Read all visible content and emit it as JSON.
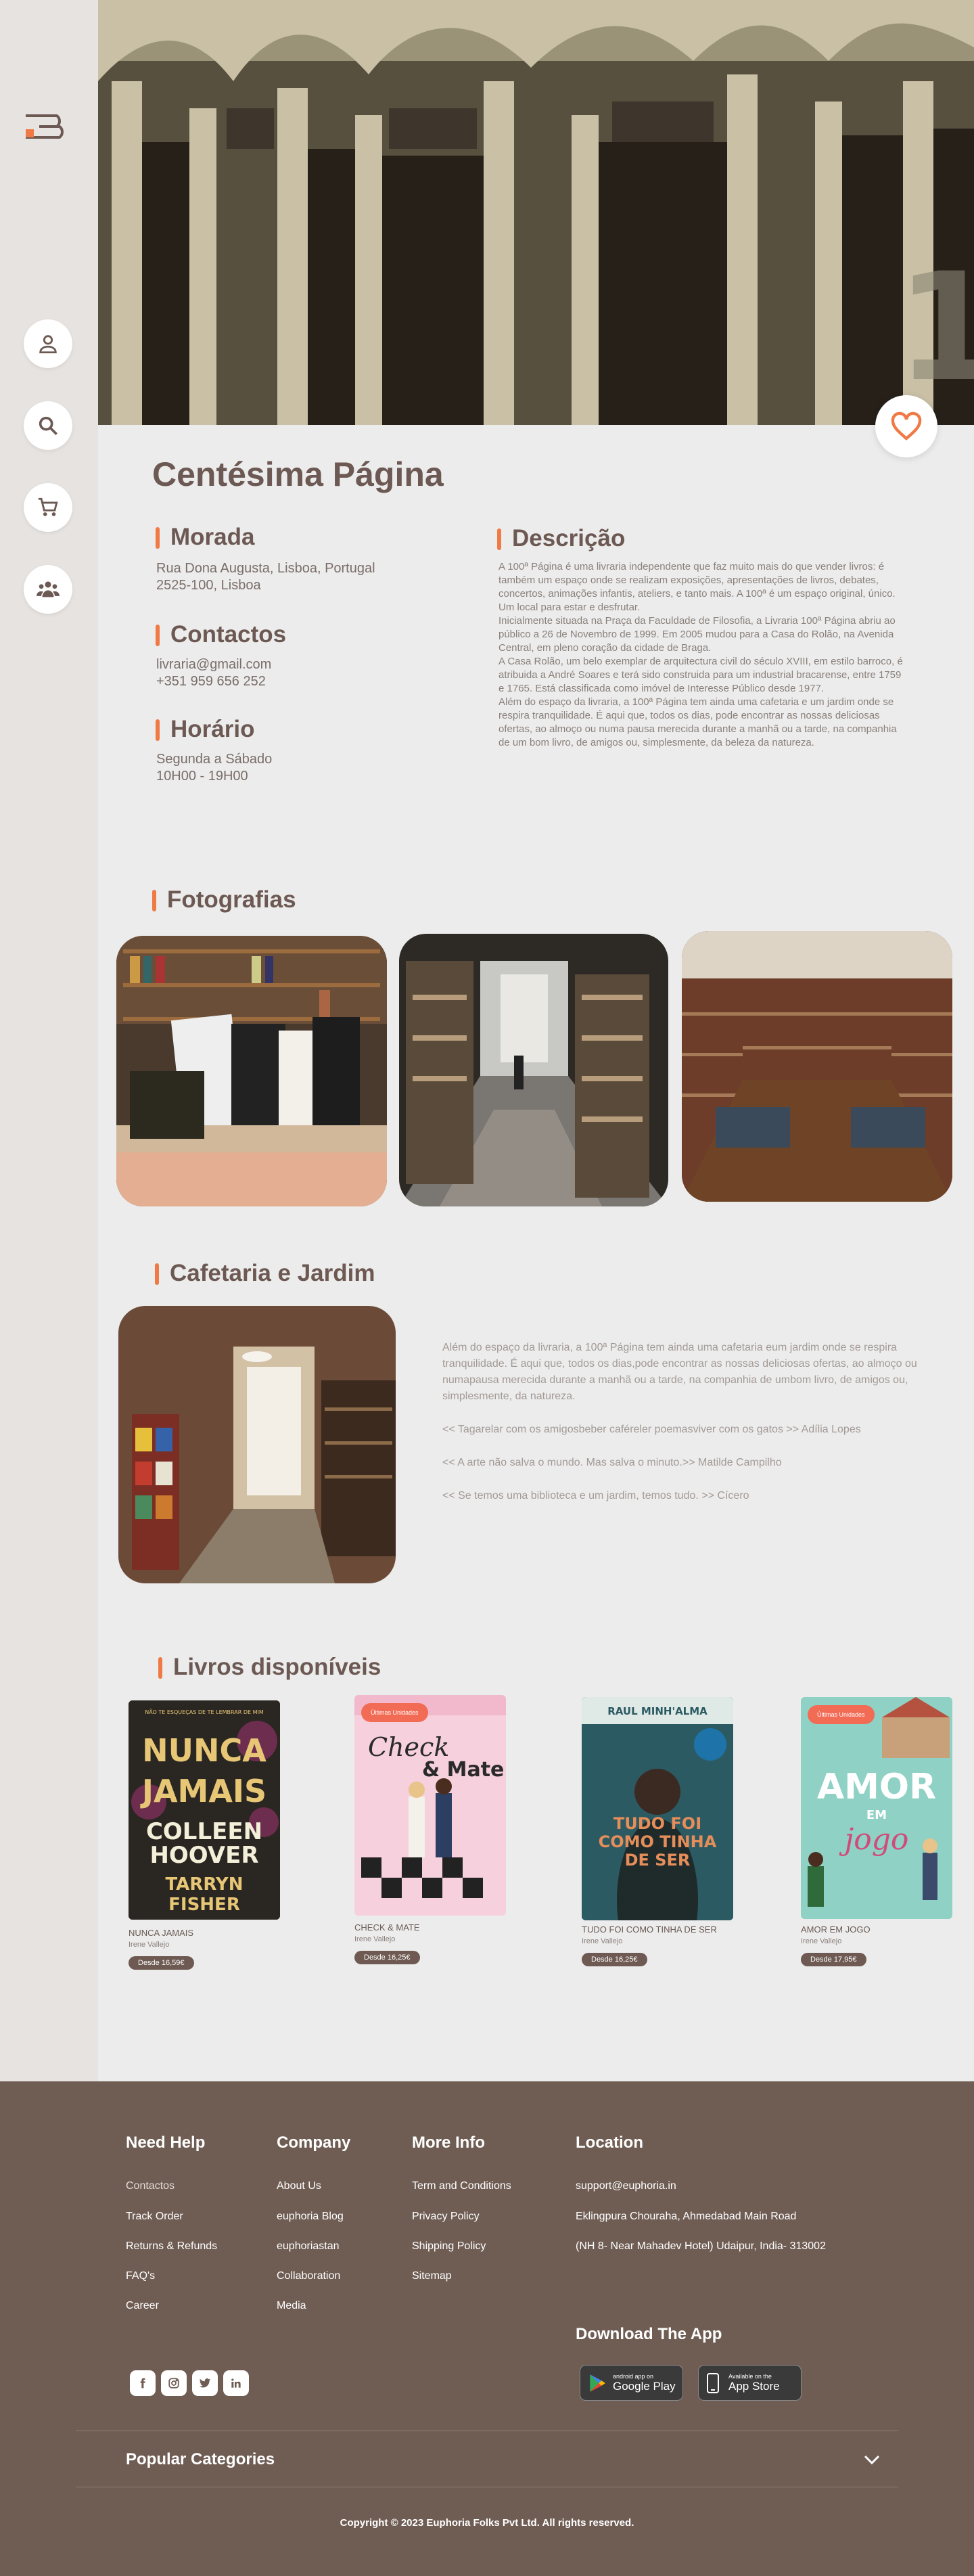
{
  "sidebar": {
    "logo_icon": "bookstore-logo-icon",
    "buttons": [
      {
        "name": "profile",
        "icon": "user-icon"
      },
      {
        "name": "search",
        "icon": "search-icon"
      },
      {
        "name": "cart",
        "icon": "cart-icon"
      },
      {
        "name": "community",
        "icon": "group-icon"
      }
    ]
  },
  "hero": {
    "favorite_icon": "heart-icon",
    "accent_color": "#ef7a45"
  },
  "store": {
    "name": "Centésima Página",
    "address_heading": "Morada",
    "address_lines": [
      "Rua Dona Augusta, Lisboa, Portugal",
      "2525-100, Lisboa"
    ],
    "contacts_heading": "Contactos",
    "contacts_lines": [
      "livraria@gmail.com",
      "+351 959 656 252"
    ],
    "hours_heading": "Horário",
    "hours_lines": [
      "Segunda a Sábado",
      "10H00 - 19H00"
    ],
    "description_heading": "Descrição",
    "description_paragraphs": [
      "A 100ª Página é uma livraria independente que faz muito mais do que vender livros: é também um espaço onde se realizam exposições, apresentações de livros, debates, concertos, animações infantis, ateliers, e tanto mais. A 100ª é um espaço original, único. Um local para estar e desfrutar.",
      "Inicialmente situada na Praça da Faculdade de Filosofia, a Livraria 100ª Página abriu ao público a 26 de Novembro de 1999. Em 2005 mudou para a Casa do Rolão, na Avenida Central, em pleno coração da cidade de Braga.",
      "A Casa Rolão, um belo exemplar de arquitectura civil do século XVIII, em estilo barroco, é atribuida a André Soares e terá sido construida para um industrial bracarense, entre 1759 e 1765. Está classificada como imóvel de Interesse Público desde 1977.",
      "Além do espaço da livraria, a 100ª Página tem ainda uma cafetaria e um jardim onde se respira tranquilidade. É aqui que, todos os dias, pode encontrar as nossas deliciosas ofertas, ao almoço ou numa pausa merecida durante a manhã ou a tarde, na companhia de um bom livro, de amigos ou, simplesmente, da beleza da natureza."
    ]
  },
  "photos": {
    "heading": "Fotografias"
  },
  "cafe": {
    "heading": "Cafetaria e Jardim",
    "paragraphs": [
      "Além do espaço da livraria, a 100ª Página tem ainda uma cafetaria eum jardim onde se respira tranquilidade. É aqui que, todos os dias,pode encontrar as nossas deliciosas ofertas, ao almoço ou numapausa merecida durante a manhã ou a tarde, na companhia de umbom livro, de amigos ou, simplesmente, da natureza.",
      "<< Tagarelar com os amigosbeber caféreler poemasviver com os gatos >> Adília Lopes",
      "<< A arte não salva o mundo. Mas salva o minuto.>> Matilde Campilho",
      "<< Se temos uma biblioteca e um jardim, temos tudo. >> Cícero"
    ]
  },
  "books": {
    "heading": "Livros disponíveis",
    "items": [
      {
        "title": "NUNCA JAMAIS",
        "author": "Irene Vallejo",
        "price": "Desde 16,59€",
        "cover_lines": [
          "NUNCA",
          "JAMAIS",
          "COLLEEN",
          "HOOVER",
          "TARRYN",
          "FISHER"
        ],
        "cover_top": "NÃO TE ESQUEÇAS DE TE LEMBRAR DE MIM",
        "color": "#2a2622"
      },
      {
        "title": "CHECK & MATE",
        "author": "Irene Vallejo",
        "price": "Desde 16,25€",
        "cover_lines": [
          "Check",
          "& Mate"
        ],
        "badge": "Últimas Unidades",
        "color": "#f4c6d6"
      },
      {
        "title": "TUDO FOI COMO TINHA DE SER",
        "author": "Irene Vallejo",
        "price": "Desde 16,25€",
        "cover_lines": [
          "RAUL MINH'ALMA",
          "TUDO FOI",
          "COMO TINHA",
          "DE SER"
        ],
        "color": "#2c5a63"
      },
      {
        "title": "AMOR EM JOGO",
        "author": "Irene Vallejo",
        "price": "Desde 17,95€",
        "cover_lines": [
          "AMOR",
          "EM",
          "jogo"
        ],
        "badge": "Últimas Unidades",
        "color": "#8fd1c4"
      }
    ]
  },
  "footer": {
    "need_help": {
      "heading": "Need Help",
      "links": [
        "Contactos",
        "Track Order",
        "Returns & Refunds",
        "FAQ's",
        "Career"
      ]
    },
    "company": {
      "heading": "Company",
      "links": [
        "About Us",
        "euphoria Blog",
        "euphoriastan",
        "Collaboration",
        "Media"
      ]
    },
    "more_info": {
      "heading": "More Info",
      "links": [
        "Term and Conditions",
        "Privacy Policy",
        "Shipping Policy",
        "Sitemap"
      ]
    },
    "location": {
      "heading": "Location",
      "lines": [
        "support@euphoria.in",
        "Eklingpura Chouraha, Ahmedabad Main Road",
        "(NH 8- Near Mahadev Hotel) Udaipur, India- 313002"
      ]
    },
    "social_icons": [
      "facebook-icon",
      "instagram-icon",
      "twitter-icon",
      "linkedin-icon"
    ],
    "download_heading": "Download The App",
    "google_play": {
      "small": "android app on",
      "big": "Google Play"
    },
    "app_store": {
      "small": "Available on the",
      "big": "App Store"
    },
    "popular_categories": "Popular Categories",
    "copyright": "Copyright © 2023 Euphoria Folks Pvt Ltd. All rights reserved."
  }
}
